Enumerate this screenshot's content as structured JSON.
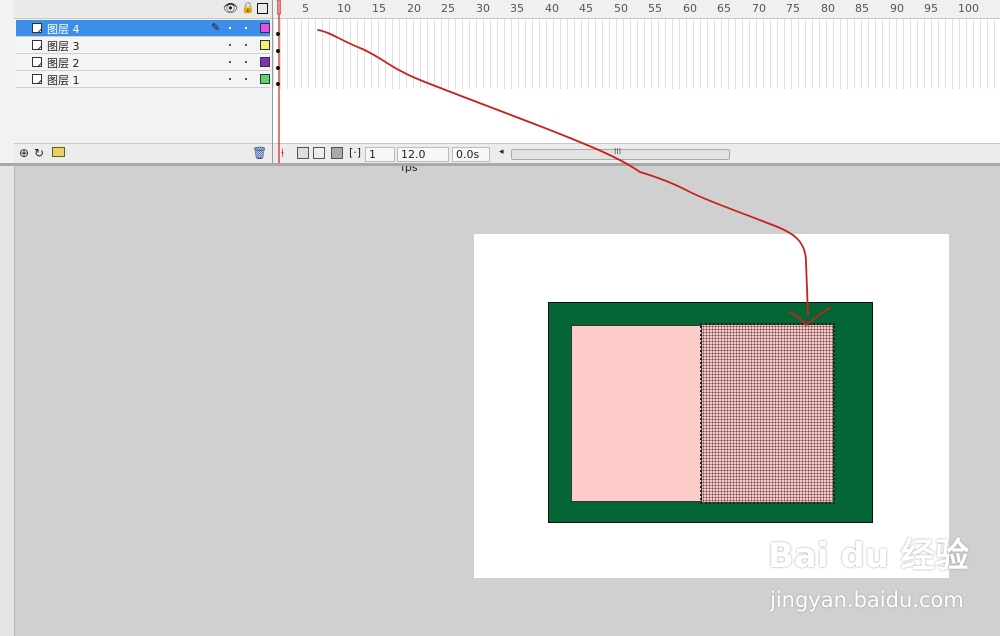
{
  "layers": [
    {
      "name": "图层 4",
      "color": "#e34ee8",
      "selected": true
    },
    {
      "name": "图层 3",
      "color": "#f3f07a",
      "selected": false
    },
    {
      "name": "图层 2",
      "color": "#7a35b5",
      "selected": false
    },
    {
      "name": "图层 1",
      "color": "#55d86a",
      "selected": false
    }
  ],
  "ruler": [
    "5",
    "10",
    "15",
    "20",
    "25",
    "30",
    "35",
    "40",
    "45",
    "50",
    "55",
    "60",
    "65",
    "70",
    "75",
    "80",
    "85",
    "90",
    "95",
    "100"
  ],
  "footer": {
    "current_frame": "1",
    "fps": "12.0 fps",
    "elapsed": "0.0s",
    "scroll_grip": "III"
  },
  "colors": {
    "stage_green": "#046535",
    "pink_fill": "#fdcbc8",
    "selection": "#3d8ee8",
    "annotation": "#c8221b"
  },
  "watermark": {
    "logo": "Bai du 经验",
    "url": "jingyan.baidu.com"
  }
}
